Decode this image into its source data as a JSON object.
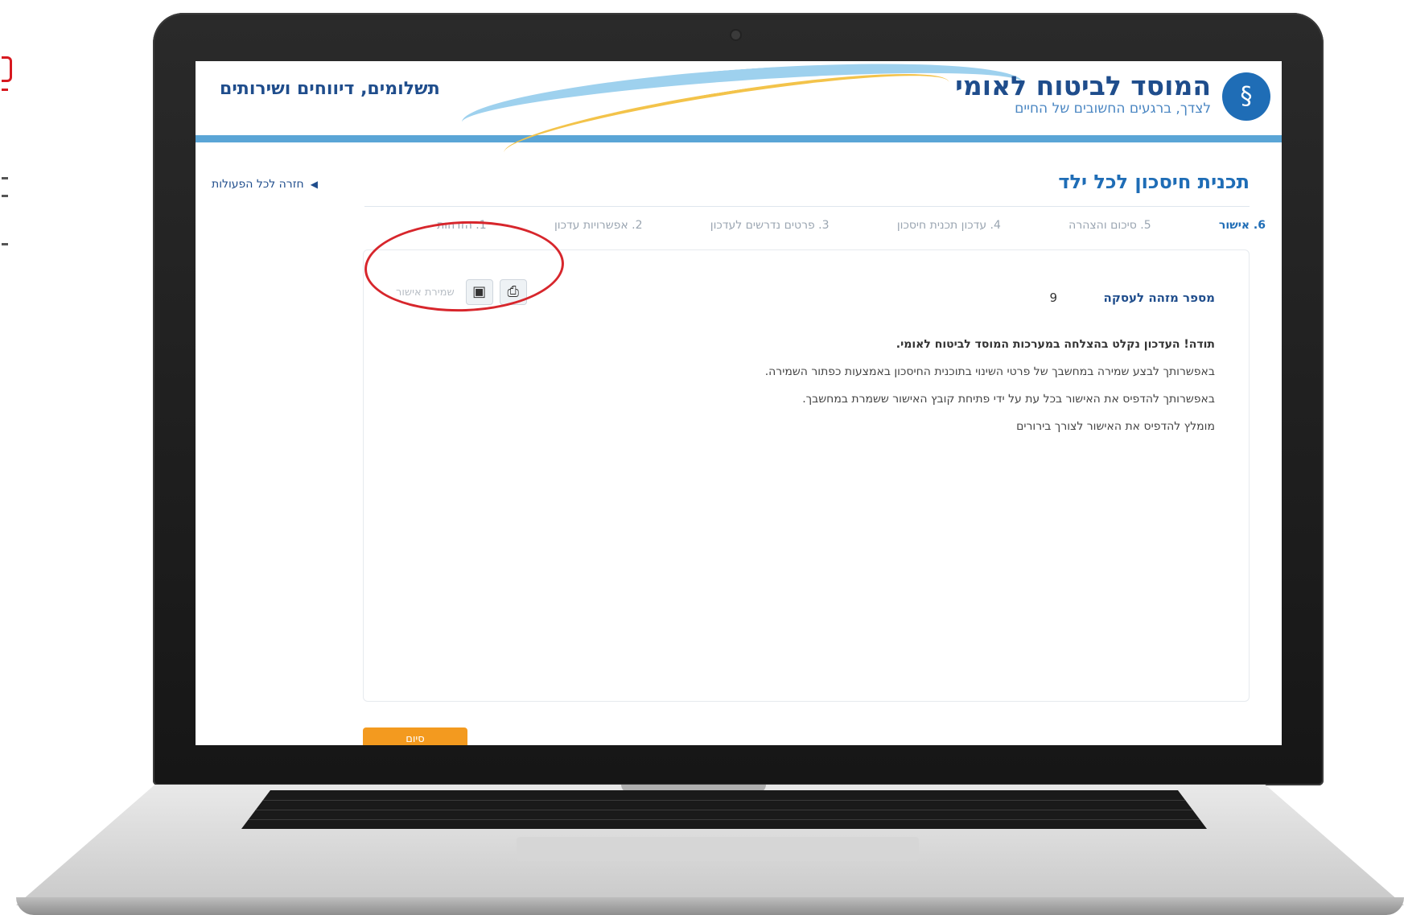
{
  "header": {
    "org_name": "המוסד לביטוח לאומי",
    "org_tagline": "לצדך, ברגעים החשובים של החיים",
    "section_title": "תשלומים, דיווחים ושירותים",
    "logo_icon": "national-insurance-logo"
  },
  "page": {
    "title": "תכנית חיסכון לכל ילד",
    "back_link": "חזרה לכל הפעולות"
  },
  "steps": [
    {
      "label": "1. הזדהות",
      "current": false
    },
    {
      "label": "2. אפשרויות עדכון",
      "current": false
    },
    {
      "label": "3. פרטים נדרשים לעדכון",
      "current": false
    },
    {
      "label": "4. עדכון תכנית חיסכון",
      "current": false
    },
    {
      "label": "5. סיכום והצהרה",
      "current": false
    },
    {
      "label": "6. אישור",
      "current": true
    }
  ],
  "confirmation": {
    "ref_label": "מספר מזהה לעסקה",
    "ref_value": "9",
    "save_label": "שמירת אישור",
    "print_icon": "printer-icon",
    "save_icon": "save-icon",
    "messages": [
      "תודה! העדכון נקלט בהצלחה במערכות המוסד לביטוח לאומי.",
      "באפשרותך לבצע שמירה במחשבך של פרטי השינוי בתוכנית החיסכון באמצעות כפתור השמירה.",
      "באפשרותך להדפיס את האישור בכל עת על ידי פתיחת קובץ האישור ששמרת במחשבך.",
      "מומלץ להדפיס את האישור לצורך בירורים"
    ]
  },
  "next_button": "סיום",
  "annotation_color": "#d7262c",
  "accent_color": "#1f6db6"
}
